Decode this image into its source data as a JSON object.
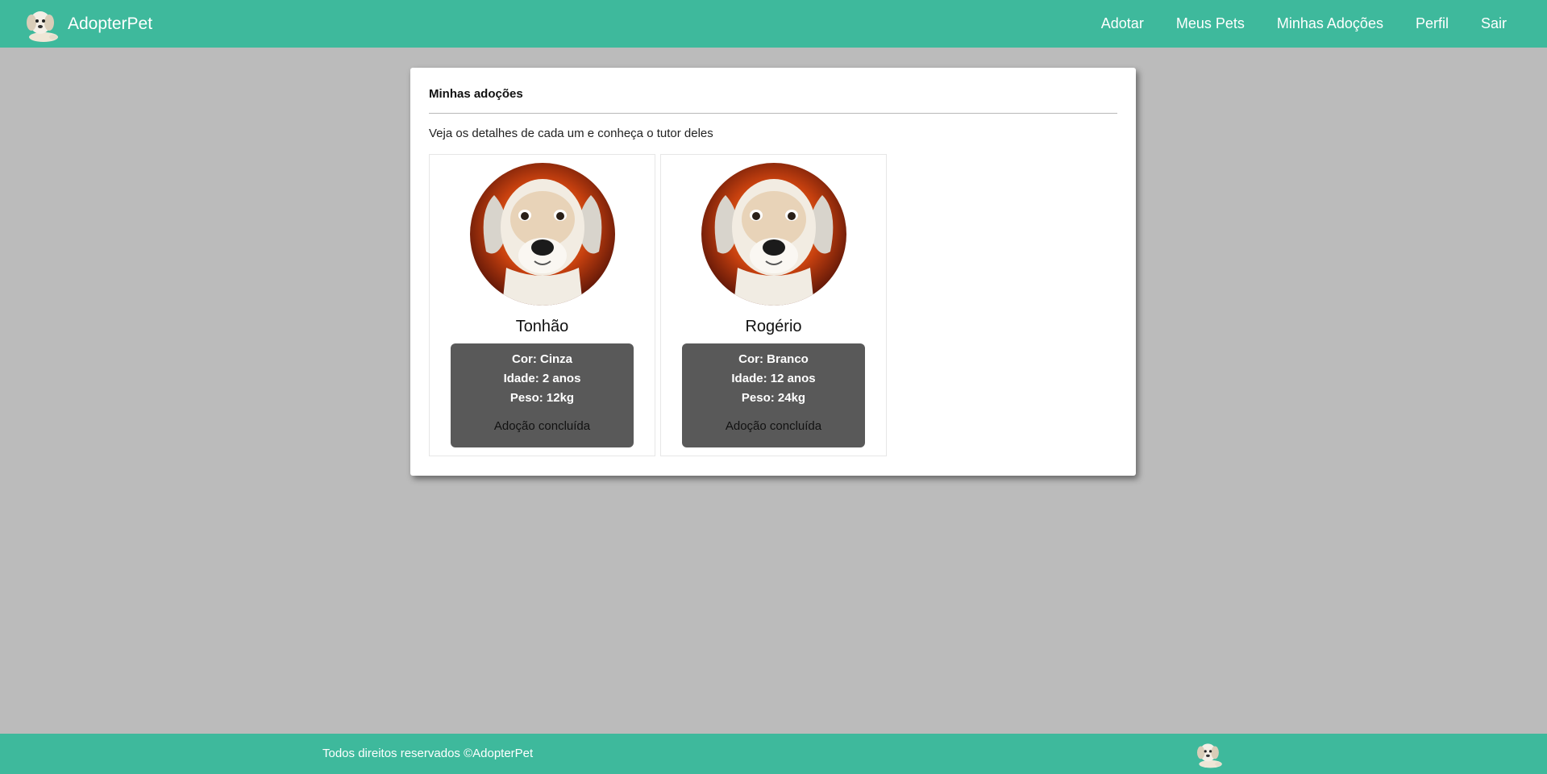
{
  "header": {
    "brand": "AdopterPet",
    "nav": [
      "Adotar",
      "Meus Pets",
      "Minhas Adoções",
      "Perfil",
      "Sair"
    ]
  },
  "main": {
    "title": "Minhas adoções",
    "subtitle": "Veja os detalhes de cada um e conheça o tutor deles",
    "pets": [
      {
        "name": "Tonhão",
        "color": "Cor: Cinza",
        "age": "Idade: 2 anos",
        "weight": "Peso: 12kg",
        "status": "Adoção concluída"
      },
      {
        "name": "Rogério",
        "color": "Cor: Branco",
        "age": "Idade: 12 anos",
        "weight": "Peso: 24kg",
        "status": "Adoção concluída"
      }
    ]
  },
  "footer": {
    "text": "Todos direitos reservados ©AdopterPet"
  },
  "colors": {
    "brand": "#3eb99c",
    "background": "#bbbbbb",
    "info_box": "#595959"
  },
  "icons": [
    "dog-logo-icon",
    "dog-photo"
  ]
}
